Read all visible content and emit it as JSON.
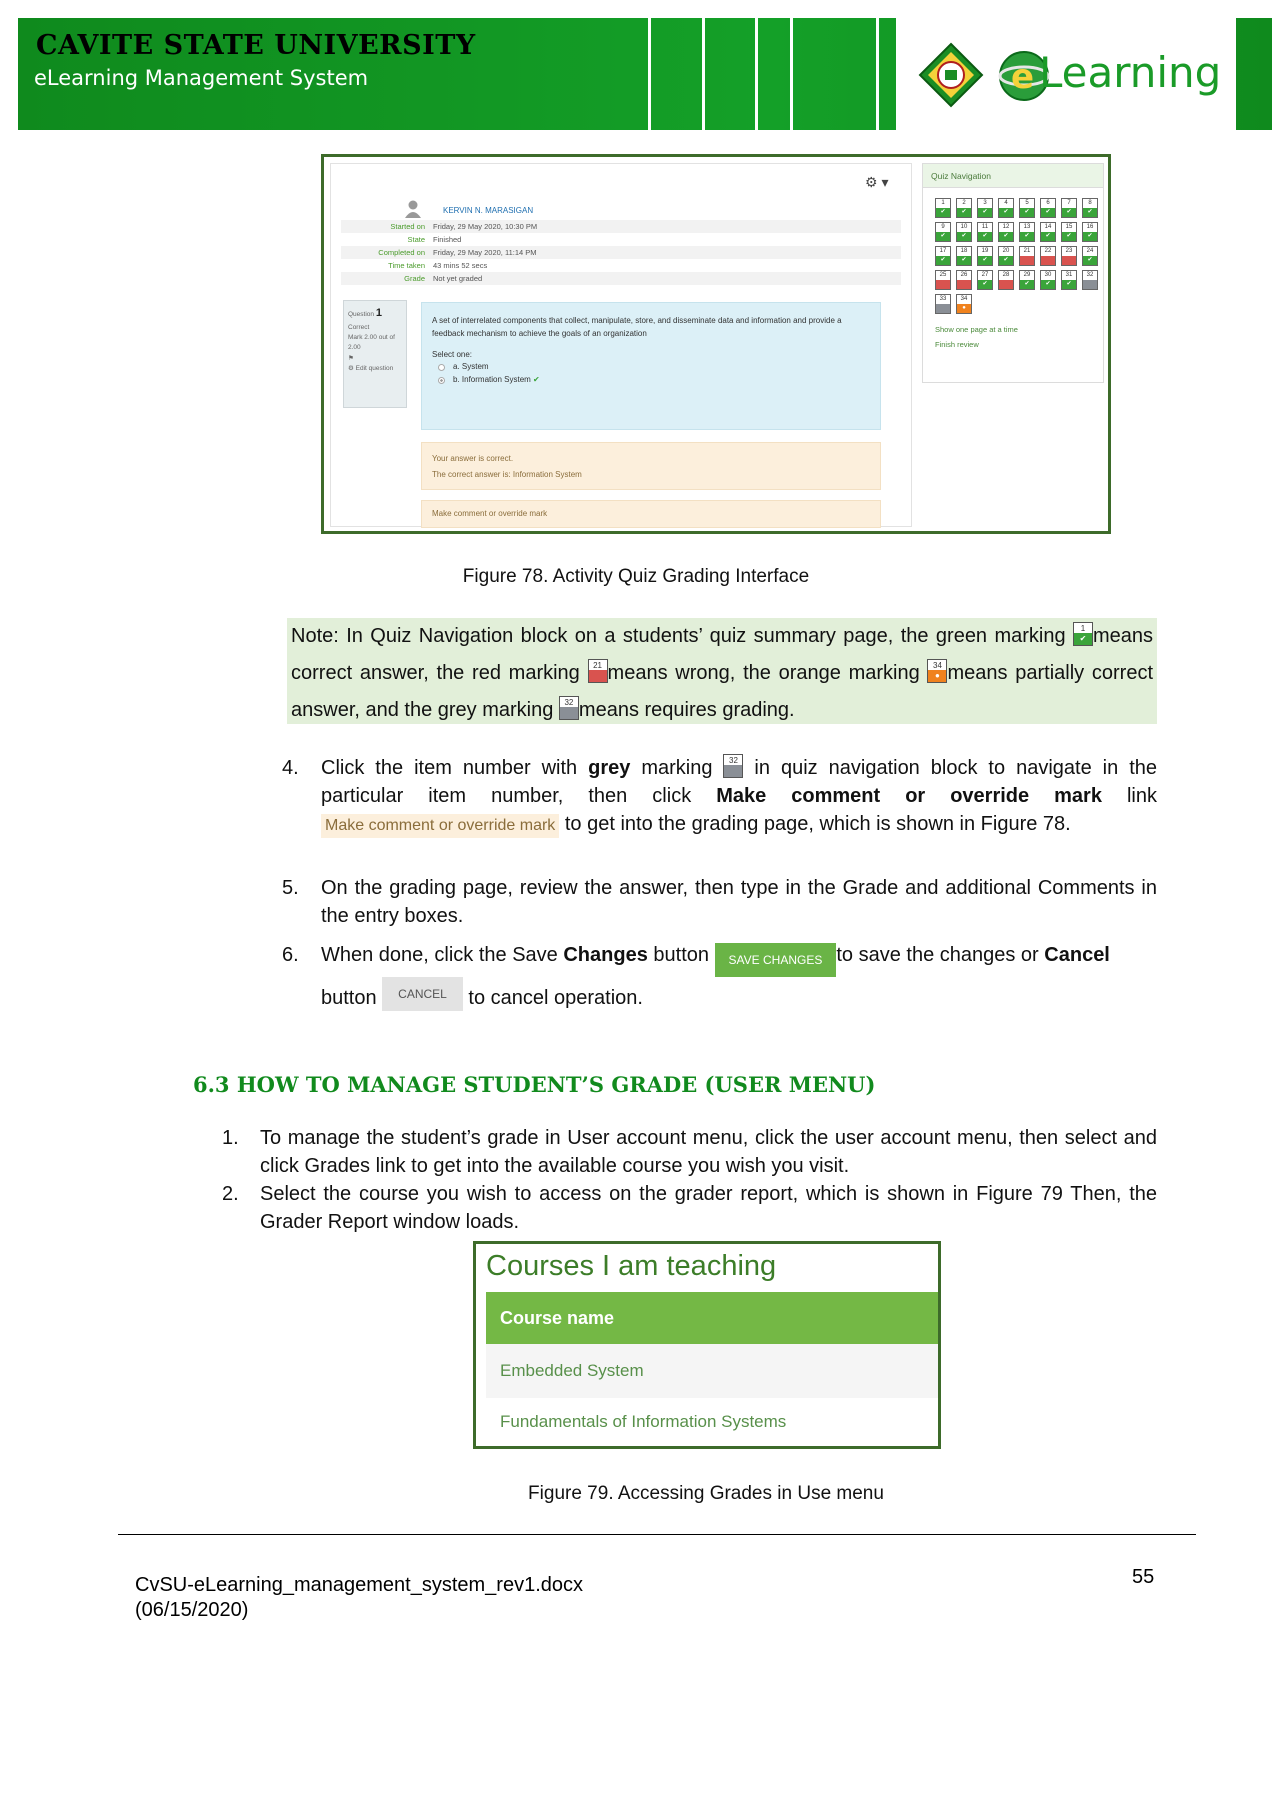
{
  "header": {
    "university": "CAVITE STATE UNIVERSITY",
    "system": "eLearning Management System",
    "logo_text": "Learning",
    "colors": {
      "banner_green": "#14a028",
      "text_dark": "#000000"
    }
  },
  "figure78": {
    "user_name": "KERVIN N. MARASIGAN",
    "info": [
      {
        "label": "Started on",
        "value": "Friday, 29 May 2020, 10:30 PM"
      },
      {
        "label": "State",
        "value": "Finished"
      },
      {
        "label": "Completed on",
        "value": "Friday, 29 May 2020, 11:14 PM"
      },
      {
        "label": "Time taken",
        "value": "43 mins 52 secs"
      },
      {
        "label": "Grade",
        "value": "Not yet graded"
      }
    ],
    "question_label": "Question",
    "question_number": "1",
    "question_status": "Correct",
    "question_mark": "Mark 2.00 out of 2.00",
    "edit_question": "Edit question",
    "question_text": "A set of interrelated components that collect, manipulate, store, and disseminate data and information and provide a feedback mechanism to achieve the goals of an organization",
    "select_one": "Select one:",
    "option_a": "a. System",
    "option_b": "b. Information System",
    "feedback_1": "Your answer is correct.",
    "feedback_2": "The correct answer is: Information System",
    "comment_link": "Make comment or override mark",
    "nav_title": "Quiz Navigation",
    "nav_items": [
      {
        "n": "1",
        "s": "ok"
      },
      {
        "n": "2",
        "s": "ok"
      },
      {
        "n": "3",
        "s": "ok"
      },
      {
        "n": "4",
        "s": "ok"
      },
      {
        "n": "5",
        "s": "ok"
      },
      {
        "n": "6",
        "s": "ok"
      },
      {
        "n": "7",
        "s": "ok"
      },
      {
        "n": "8",
        "s": "ok"
      },
      {
        "n": "9",
        "s": "ok"
      },
      {
        "n": "10",
        "s": "ok"
      },
      {
        "n": "11",
        "s": "ok"
      },
      {
        "n": "12",
        "s": "ok"
      },
      {
        "n": "13",
        "s": "ok"
      },
      {
        "n": "14",
        "s": "ok"
      },
      {
        "n": "15",
        "s": "ok"
      },
      {
        "n": "16",
        "s": "ok"
      },
      {
        "n": "17",
        "s": "ok"
      },
      {
        "n": "18",
        "s": "ok"
      },
      {
        "n": "19",
        "s": "ok"
      },
      {
        "n": "20",
        "s": "ok"
      },
      {
        "n": "21",
        "s": "bad"
      },
      {
        "n": "22",
        "s": "bad"
      },
      {
        "n": "23",
        "s": "bad"
      },
      {
        "n": "24",
        "s": "ok"
      },
      {
        "n": "25",
        "s": "bad"
      },
      {
        "n": "26",
        "s": "bad"
      },
      {
        "n": "27",
        "s": "ok"
      },
      {
        "n": "28",
        "s": "bad"
      },
      {
        "n": "29",
        "s": "ok"
      },
      {
        "n": "30",
        "s": "ok"
      },
      {
        "n": "31",
        "s": "ok"
      },
      {
        "n": "32",
        "s": "grey"
      },
      {
        "n": "33",
        "s": "grey"
      },
      {
        "n": "34",
        "s": "part"
      }
    ],
    "nav_link_1": "Show one page at a time",
    "nav_link_2": "Finish review",
    "caption": "Figure 78. Activity Quiz Grading Interface"
  },
  "note": {
    "label": "Note:",
    "t1": " In Quiz Navigation block on a students’ quiz summary page, the green marking ",
    "t2": "means correct answer, the red marking ",
    "t3": "means wrong, the orange marking ",
    "t4": "means partially correct answer, and the grey marking ",
    "t5": "means requires grading.",
    "m_green": "1",
    "m_red": "21",
    "m_orange": "34",
    "m_grey": "32"
  },
  "steps": {
    "s4_num": "4.",
    "s4_a": "Click the item number with ",
    "s4_grey": "grey",
    "s4_b": " marking ",
    "s4_c": " in quiz navigation block to navigate in the particular item number, then click ",
    "s4_bold": "Make comment or override mark",
    "s4_d": " link ",
    "s4_link": "Make comment or override mark",
    "s4_e": " to get into the grading page, which is shown in Figure 78.",
    "s4_marker": "32",
    "s5_num": "5.",
    "s5_text": "On the grading page, review the answer, then type in the Grade and additional Comments in the entry boxes.",
    "s6_num": "6.",
    "s6_a": "When done, click the Save ",
    "s6_changes": "Changes",
    "s6_b": " button ",
    "s6_save_btn": "SAVE CHANGES",
    "s6_c": "to save the changes or ",
    "s6_cancel": "Cancel",
    "s6_d": "button ",
    "s6_cancel_btn": "CANCEL",
    "s6_e": " to cancel operation."
  },
  "section": {
    "heading": "6.3 HOW TO MANAGE STUDENT’S GRADE (USER MENU)",
    "i1_num": "1.",
    "i1_text": "To manage the student’s grade in User account menu, click the user account menu, then select and click Grades link to get into the available course you wish you visit.",
    "i2_num": "2.",
    "i2_text": "Select the course you wish to access on the grader report, which is shown in Figure 79 Then, the Grader Report window loads."
  },
  "figure79": {
    "title": "Courses I am teaching",
    "header": "Course name",
    "courses": [
      "Embedded System",
      "Fundamentals of Information Systems"
    ],
    "caption": "Figure 79. Accessing Grades in Use menu"
  },
  "footer": {
    "doc": "CvSU-eLearning_management_system_rev1.docx",
    "date": "(06/15/2020)",
    "page": "55"
  }
}
